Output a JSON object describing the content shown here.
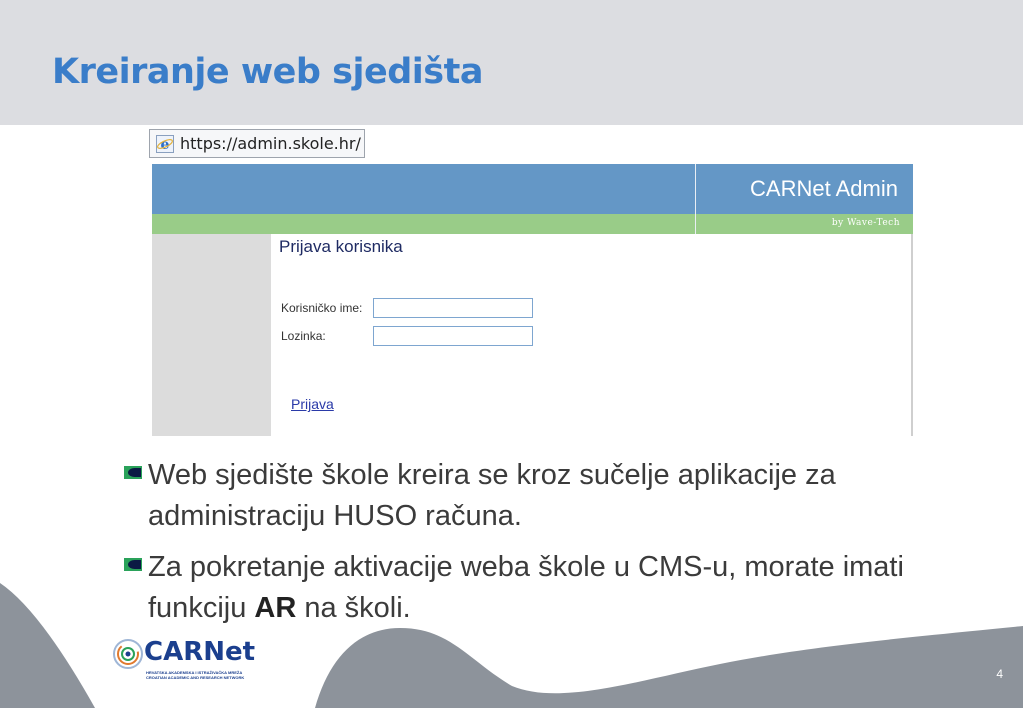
{
  "slide": {
    "title": "Kreiranje web sjedišta",
    "page_number": "4"
  },
  "browser": {
    "address": "https://admin.skole.hr/"
  },
  "admin": {
    "brand": "CARNet Admin",
    "byline": "by Wave-Tech",
    "login_title": "Prijava korisnika",
    "username_label": "Korisničko ime:",
    "username_value": "",
    "password_label": "Lozinka:",
    "password_value": "",
    "login_link": "Prijava"
  },
  "bullets": [
    {
      "text": "Web sjedište škole kreira se kroz sučelje aplikacije za administraciju HUSO računa."
    },
    {
      "text_before": "Za pokretanje aktivacije weba škole u CMS-u, morate imati funkciju ",
      "text_bold": "AR",
      "text_after": " na školi."
    }
  ],
  "logo": {
    "name": "CARNet",
    "sub_line_1": "HRVATSKA AKADEMSKA I ISTRAŽIVAČKA MREŽA",
    "sub_line_2": "CROATIAN ACADEMIC AND RESEARCH NETWORK"
  },
  "colors": {
    "title": "#3a7dc9",
    "header_blue": "#6497c6",
    "header_green": "#99cc88",
    "deco_gray": "#8d939b"
  }
}
